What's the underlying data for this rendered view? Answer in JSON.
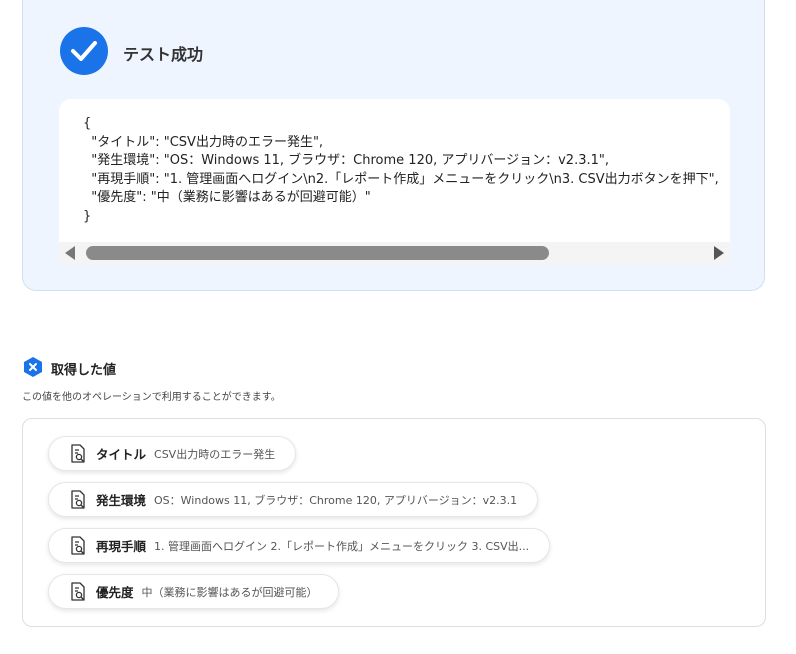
{
  "success": {
    "title": "テスト成功",
    "code_text": "{\n  \"タイトル\": \"CSV出力時のエラー発生\",\n  \"発生環境\": \"OS：Windows 11, ブラウザ：Chrome 120, アプリバージョン：v2.3.1\",\n  \"再現手順\": \"1. 管理画面へログイン\\n2.「レポート作成」メニューをクリック\\n3. CSV出力ボタンを押下\",\n  \"優先度\": \"中（業務に影響はあるが回避可能）\"\n}",
    "icon": "check-icon",
    "accent_color": "#1a73e8"
  },
  "acquired": {
    "title": "取得した値",
    "description": "この値を他のオペレーションで利用することができます。",
    "badge_icon": "x-icon",
    "items": [
      {
        "label": "タイトル",
        "value": "CSV出力時のエラー発生",
        "icon": "document-search-icon"
      },
      {
        "label": "発生環境",
        "value": "OS：Windows 11, ブラウザ：Chrome 120, アプリバージョン：v2.3.1",
        "icon": "document-search-icon"
      },
      {
        "label": "再現手順",
        "value": "1. 管理画面へログイン 2.「レポート作成」メニューをクリック 3. CSV出...",
        "icon": "document-search-icon"
      },
      {
        "label": "優先度",
        "value": "中（業務に影響はあるが回避可能）",
        "icon": "document-search-icon"
      }
    ]
  }
}
